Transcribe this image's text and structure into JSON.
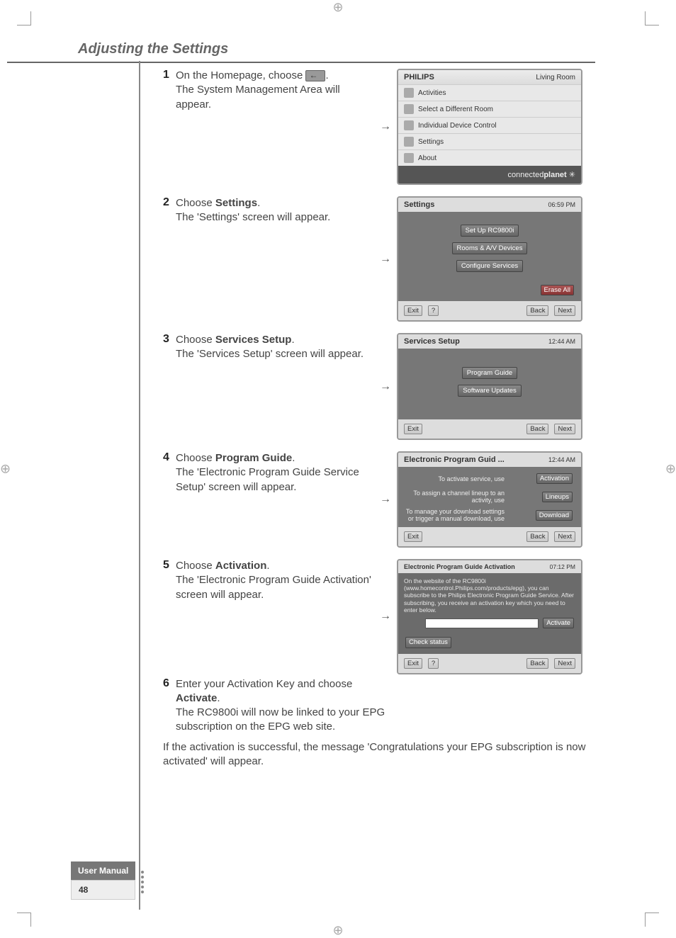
{
  "page": {
    "section_title": "Adjusting the Settings",
    "footer_label": "User Manual",
    "page_number": "48"
  },
  "steps": {
    "s1": {
      "num": "1",
      "line1": "On the Homepage, choose ",
      "line2": "The System Management Area will appear."
    },
    "s2": {
      "num": "2",
      "line1a": "Choose ",
      "line1b": "Settings",
      "line1c": ".",
      "line2": "The 'Settings' screen will appear."
    },
    "s3": {
      "num": "3",
      "line1a": "Choose ",
      "line1b": "Services Setup",
      "line1c": ".",
      "line2": "The 'Services Setup' screen will appear."
    },
    "s4": {
      "num": "4",
      "line1a": "Choose ",
      "line1b": "Program Guide",
      "line1c": ".",
      "line2": "The 'Electronic Program Guide Service Setup' screen will appear."
    },
    "s5": {
      "num": "5",
      "line1a": "Choose ",
      "line1b": "Activation",
      "line1c": ".",
      "line2": "The 'Electronic Program Guide Activation' screen will appear."
    },
    "s6": {
      "num": "6",
      "line1a": "Enter your Activation Key and choose ",
      "line1b": "Activate",
      "line1c": ".",
      "line2": "The RC9800i will now be linked to your EPG subscription on the EPG web site."
    },
    "closing": "If the activation is successful, the message 'Congratulations your EPG subscription is now activated' will appear."
  },
  "shots": {
    "home": {
      "brand": "PHILIPS",
      "room": "Living Room",
      "items": [
        "Activities",
        "Select a Different Room",
        "Individual Device Control",
        "Settings",
        "About"
      ],
      "footer_a": "connected",
      "footer_b": "planet"
    },
    "settings": {
      "title": "Settings",
      "time": "06:59 PM",
      "buttons": [
        "Set Up RC9800i",
        "Rooms & A/V Devices",
        "Configure Services"
      ],
      "erase": "Erase All",
      "exit": "Exit",
      "help": "?",
      "back": "Back",
      "next": "Next"
    },
    "services": {
      "title": "Services Setup",
      "time": "12:44 AM",
      "buttons": [
        "Program Guide",
        "Software Updates"
      ],
      "exit": "Exit",
      "back": "Back",
      "next": "Next"
    },
    "epg": {
      "title": "Electronic Program Guid ...",
      "time": "12:44 AM",
      "rows": [
        {
          "label": "To activate service, use",
          "btn": "Activation"
        },
        {
          "label": "To assign a channel lineup to an activity, use",
          "btn": "Lineups"
        },
        {
          "label": "To manage your download settings or trigger a manual download, use",
          "btn": "Download"
        }
      ],
      "exit": "Exit",
      "back": "Back",
      "next": "Next"
    },
    "activation": {
      "title": "Electronic Program Guide Activation",
      "time": "07:12 PM",
      "body": "On the website of the RC9800i (www.homecontrol.Philips.com/products/epg), you can subscribe to the Philips Electronic Program Guide Service. After subscribing, you receive an activation key which you need to enter below.",
      "activate": "Activate",
      "check": "Check status",
      "exit": "Exit",
      "help": "?",
      "back": "Back",
      "next": "Next"
    }
  }
}
